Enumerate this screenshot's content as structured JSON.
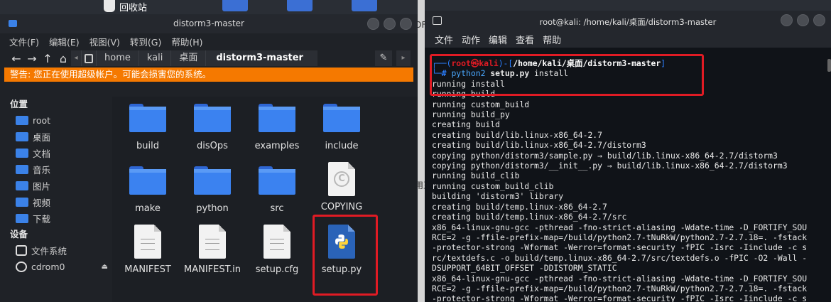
{
  "desktop": {
    "trash_label": "回收站",
    "edge_text_1": "OF",
    "edge_text_2": "用王"
  },
  "file_manager": {
    "title": "distorm3-master",
    "menu": [
      "文件(F)",
      "编辑(E)",
      "视图(V)",
      "转到(G)",
      "帮助(H)"
    ],
    "breadcrumbs": [
      "home",
      "kali",
      "桌面",
      "distorm3-master"
    ],
    "warning": "警告: 您正在使用超级帐户。可能会损害您的系统。",
    "sidebar": {
      "places_header": "位置",
      "places": [
        "root",
        "桌面",
        "文档",
        "音乐",
        "图片",
        "视频",
        "下载"
      ],
      "devices_header": "设备",
      "devices": [
        "文件系统",
        "cdrom0"
      ]
    },
    "files": [
      "build",
      "disOps",
      "examples",
      "include",
      "make",
      "python",
      "src",
      "COPYING",
      "MANIFEST",
      "MANIFEST.in",
      "setup.cfg",
      "setup.py"
    ]
  },
  "terminal": {
    "title": "root@kali: /home/kali/桌面/distorm3-master",
    "menu": [
      "文件",
      "动作",
      "编辑",
      "查看",
      "帮助"
    ],
    "prompt_user": "root㉿kali",
    "prompt_path": "/home/kali/桌面/distorm3-master",
    "command": "python2",
    "command_bold": "setup.py",
    "command_rest": "install",
    "output": [
      "running install",
      "running build",
      "running custom_build",
      "running build_py",
      "creating build",
      "creating build/lib.linux-x86_64-2.7",
      "creating build/lib.linux-x86_64-2.7/distorm3",
      "copying python/distorm3/sample.py → build/lib.linux-x86_64-2.7/distorm3",
      "copying python/distorm3/__init__.py → build/lib.linux-x86_64-2.7/distorm3",
      "running build_clib",
      "running custom_build_clib",
      "building 'distorm3' library",
      "creating build/temp.linux-x86_64-2.7",
      "creating build/temp.linux-x86_64-2.7/src",
      "x86_64-linux-gnu-gcc -pthread -fno-strict-aliasing -Wdate-time -D_FORTIFY_SOU",
      "RCE=2 -g -ffile-prefix-map=/build/python2.7-tNuRkW/python2.7-2.7.18=. -fstack",
      "-protector-strong -Wformat -Werror=format-security -fPIC -Isrc -Iinclude -c s",
      "rc/textdefs.c -o build/temp.linux-x86_64-2.7/src/textdefs.o -fPIC -O2 -Wall -",
      "DSUPPORT_64BIT_OFFSET -DDISTORM_STATIC",
      "x86_64-linux-gnu-gcc -pthread -fno-strict-aliasing -Wdate-time -D_FORTIFY_SOU",
      "RCE=2 -g -ffile-prefix-map=/build/python2.7-tNuRkW/python2.7-2.7.18=. -fstack",
      "-protector-strong -Wformat -Werror=format-security -fPIC -Isrc -Iinclude -c s"
    ]
  },
  "colors": {
    "warning_bg": "#f57900",
    "folder": "#3b82f0",
    "highlight": "#e01b24",
    "prompt_blue": "#2b7fff"
  }
}
